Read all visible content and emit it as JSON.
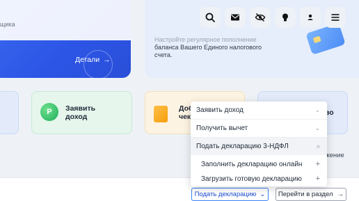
{
  "hero": {
    "subtitle_fragment": "щика",
    "details_label": "Детали",
    "info_line1": "Настройте регулярное пополнение",
    "info_line2": "баланса Вашего Единого налогового",
    "info_line3": "счета."
  },
  "header": {
    "icons": [
      "search-icon",
      "mail-icon",
      "visibility-off-icon",
      "lightbulb-icon",
      "user-icon",
      "menu-icon"
    ]
  },
  "tiles": {
    "declare_income": "Заявить доход",
    "declare_income_line1": "Заявить",
    "declare_income_line2": "доход",
    "yellow_fragment1": "Доб",
    "yellow_fragment2": "чек",
    "blue_fragment": "ство",
    "green_icon_letter": "Р"
  },
  "side_text": "ажение",
  "dropdown": {
    "items": [
      {
        "label": "Заявить доход",
        "expanded": false
      },
      {
        "label": "Получить вычет",
        "expanded": false
      },
      {
        "label": "Подать декларацию 3-НДФЛ",
        "expanded": true
      }
    ],
    "subitems": [
      {
        "label": "Заполнить декларацию онлайн"
      },
      {
        "label": "Загрузить готовую декларацию"
      }
    ]
  },
  "buttons": {
    "submit_declaration": "Подать декларацию",
    "go_to_section": "Перейти в раздел"
  },
  "colors": {
    "accent_blue": "#2c55e6",
    "green_tile": "#e6f6ec",
    "yellow_tile": "#fdf3e2"
  }
}
